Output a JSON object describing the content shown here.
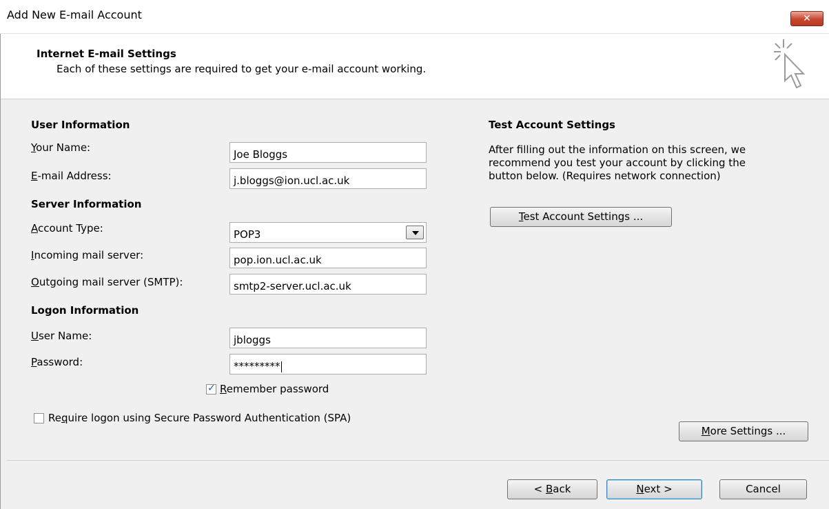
{
  "window": {
    "title": "Add New E-mail Account",
    "close_label": "✕"
  },
  "header": {
    "title": "Internet E-mail Settings",
    "subtitle": "Each of these settings are required to get your e-mail account working.",
    "icon": "cursor-sparkle-icon"
  },
  "user_info": {
    "heading": "User Information",
    "name_label": "Your Name:",
    "name_value": "Joe Bloggs",
    "email_label": "E-mail Address:",
    "email_value": "j.bloggs@ion.ucl.ac.uk"
  },
  "server_info": {
    "heading": "Server Information",
    "account_type_label": "Account Type:",
    "account_type_value": "POP3",
    "incoming_label": "Incoming mail server:",
    "incoming_value": "pop.ion.ucl.ac.uk",
    "outgoing_label": "Outgoing mail server (SMTP):",
    "outgoing_value": "smtp2-server.ucl.ac.uk"
  },
  "logon_info": {
    "heading": "Logon Information",
    "username_label": "User Name:",
    "username_value": "jbloggs",
    "password_label": "Password:",
    "password_value": "*********",
    "remember_label": "Remember password",
    "remember_checked": true,
    "spa_label": "Require logon using Secure Password Authentication (SPA)",
    "spa_checked": false
  },
  "test": {
    "heading": "Test Account Settings",
    "desc1": "After filling out the information on this screen, we",
    "desc2": "recommend you test your account by clicking the",
    "desc3": "button below. (Requires network connection)",
    "button": "Test Account Settings ..."
  },
  "more_settings": "More Settings ...",
  "footer": {
    "back": "< Back",
    "next": "Next >",
    "cancel": "Cancel"
  },
  "colors": {
    "default_border": "#3c7fb1",
    "close_red": "#c7462f",
    "check_blue": "#2b5f94"
  }
}
